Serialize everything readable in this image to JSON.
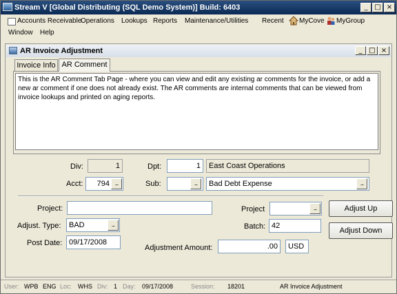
{
  "window": {
    "title": "Stream V [Global Distributing (SQL Demo System)] Build: 6403",
    "minimize": "_",
    "maximize": "□",
    "close": "×"
  },
  "menu": {
    "row1": [
      "Accounts Receivable",
      "Operations",
      "Lookups",
      "Reports",
      "Maintenance/Utilities"
    ],
    "recent": "Recent",
    "mycove": "MyCove",
    "mygroup": "MyGroup",
    "row2": [
      "Window",
      "Help"
    ]
  },
  "child": {
    "title": "AR Invoice Adjustment",
    "minimize": "_",
    "maximize": "□",
    "close": "×"
  },
  "tabs": [
    "Invoice Info",
    "AR Comment"
  ],
  "active_tab": "AR Comment",
  "comment": "This is the AR Comment Tab Page - where you can view and edit any existing ar comments for the invoice, or add a new ar comment if one does not already exist.  The AR comments are internal comments that can be viewed from invoice lookups and printed on aging reports.",
  "form": {
    "div_label": "Div:",
    "div_value": "1",
    "dpt_label": "Dpt:",
    "dpt_value": "1",
    "dpt_name": "East Coast Operations",
    "acct_label": "Acct:",
    "acct_value": "794",
    "sub_label": "Sub:",
    "sub_value": "",
    "sub_name": "Bad Debt Expense",
    "project_label": "Project:",
    "project_value": "",
    "project2_label": "Project",
    "project2_value": "",
    "adj_type_label": "Adjust. Type:",
    "adj_type_value": "BAD",
    "batch_label": "Batch:",
    "batch_value": "42",
    "post_date_label": "Post Date:",
    "post_date_value": "09/17/2008",
    "amount_label": "Adjustment Amount:",
    "amount_value": ".00",
    "currency": "USD",
    "dots": "..."
  },
  "buttons": {
    "adjust_up": "Adjust Up",
    "adjust_down": "Adjust Down"
  },
  "status": {
    "user_label": "User:",
    "user": "WPB",
    "lang": "ENG",
    "loc_label": "Loc:",
    "loc": "WHS",
    "div_label": "Div:",
    "div": "1",
    "day_label": "Day:",
    "day": "09/17/2008",
    "session_label": "Session:",
    "session": "18201",
    "screen": "AR Invoice Adjustment"
  }
}
